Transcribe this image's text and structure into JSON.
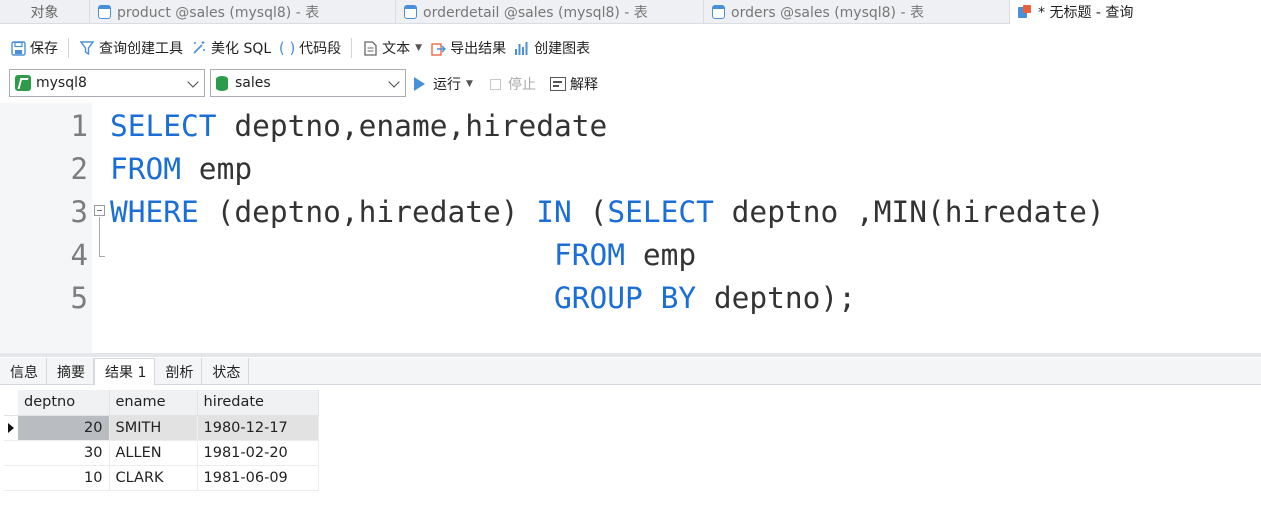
{
  "tabs": {
    "objects": "对象",
    "items": [
      {
        "label": "product @sales (mysql8) - 表",
        "icon": "table-icon"
      },
      {
        "label": "orderdetail @sales (mysql8) - 表",
        "icon": "table-icon"
      },
      {
        "label": "orders @sales (mysql8) - 表",
        "icon": "table-icon"
      }
    ],
    "active": "* 无标题 - 查询"
  },
  "toolbar": {
    "save": "保存",
    "query_builder": "查询创建工具",
    "beautify": "美化 SQL",
    "snippet": "代码段",
    "text": "文本",
    "export": "导出结果",
    "chart": "创建图表"
  },
  "connection": {
    "selected": "mysql8",
    "database": "sales",
    "run": "运行",
    "stop": "停止",
    "explain": "解释"
  },
  "editor": {
    "lines": [
      {
        "n": "1"
      },
      {
        "n": "2"
      },
      {
        "n": "3"
      },
      {
        "n": "4"
      },
      {
        "n": "5"
      }
    ],
    "code": {
      "l1_kw": "SELECT",
      "l1_rest": " deptno,ename,hiredate",
      "l2_kw": "FROM",
      "l2_rest": " emp",
      "l3_kw1": "WHERE",
      "l3_mid": " (deptno,hiredate) ",
      "l3_kw2": "IN",
      "l3_paren": " (",
      "l3_kw3": "SELECT",
      "l3_rest": " deptno ,MIN(hiredate)",
      "l4_pad": "                         ",
      "l4_kw": "FROM",
      "l4_rest": " emp",
      "l5_pad": "                         ",
      "l5_kw": "GROUP BY",
      "l5_rest": " deptno);"
    }
  },
  "result_tabs": [
    "信息",
    "摘要",
    "结果 1",
    "剖析",
    "状态"
  ],
  "result_active": "结果 1",
  "grid": {
    "columns": [
      "deptno",
      "ename",
      "hiredate"
    ],
    "rows": [
      {
        "deptno": "20",
        "ename": "SMITH",
        "hiredate": "1980-12-17"
      },
      {
        "deptno": "30",
        "ename": "ALLEN",
        "hiredate": "1981-02-20"
      },
      {
        "deptno": "10",
        "ename": "CLARK",
        "hiredate": "1981-06-09"
      }
    ]
  },
  "colors": {
    "keyword": "#1a6ed8",
    "accent": "#4a90d9",
    "db_green": "#2e9b4a"
  }
}
